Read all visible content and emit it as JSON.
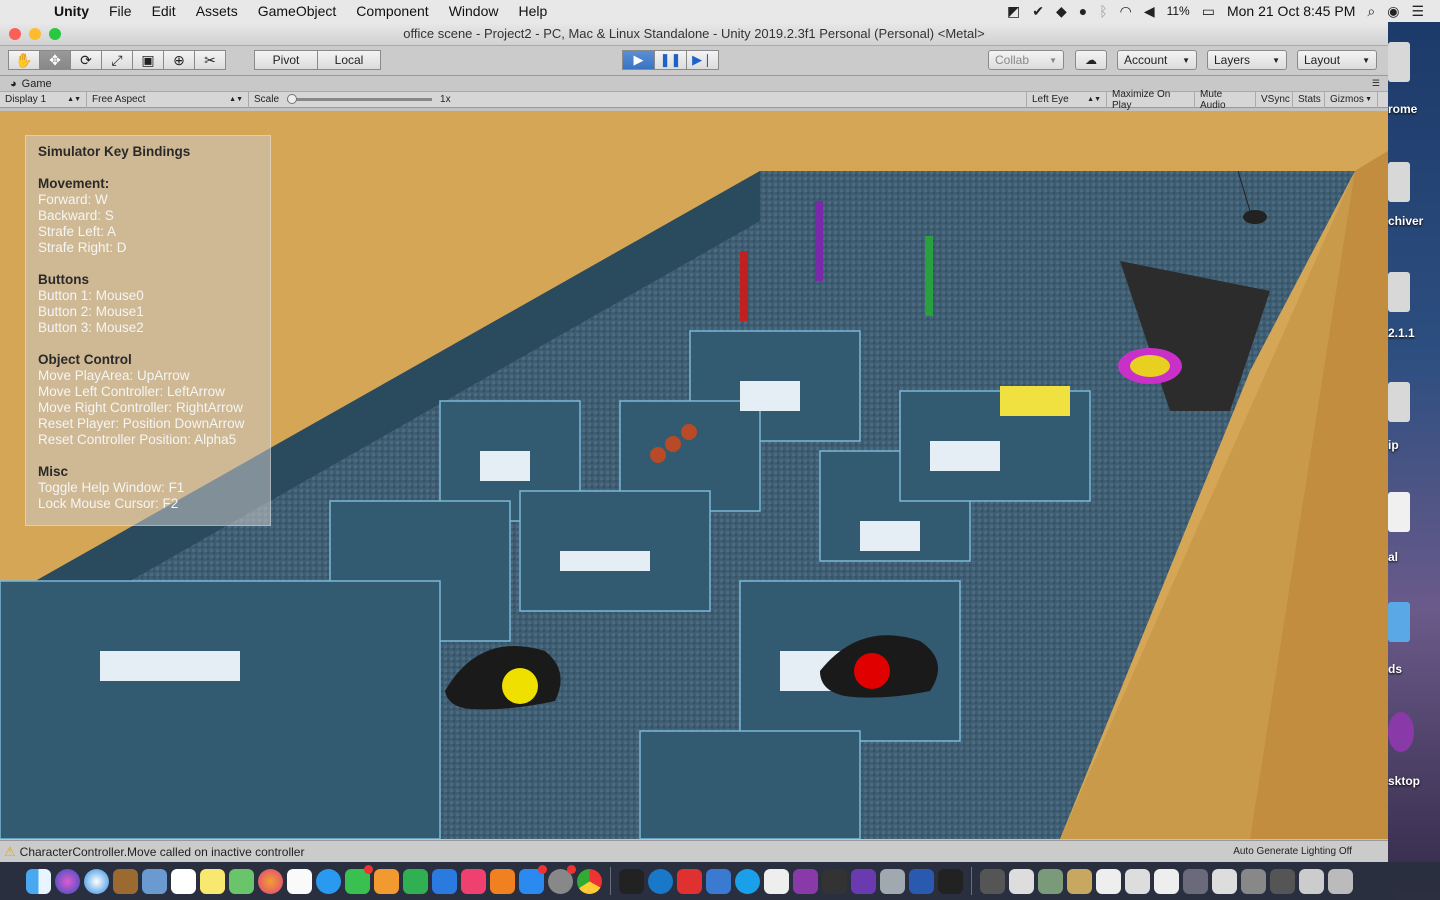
{
  "menubar": {
    "app_name": "Unity",
    "items": [
      "File",
      "Edit",
      "Assets",
      "GameObject",
      "Component",
      "Window",
      "Help"
    ],
    "battery": "11%",
    "datetime": "Mon 21 Oct  8:45 PM"
  },
  "window": {
    "title": "office scene - Project2 - PC, Mac & Linux Standalone - Unity 2019.2.3f1 Personal (Personal) <Metal>"
  },
  "toolbar": {
    "pivot_label": "Pivot",
    "local_label": "Local",
    "collab_label": "Collab",
    "account_label": "Account",
    "layers_label": "Layers",
    "layout_label": "Layout"
  },
  "game_view": {
    "tab_label": "Game",
    "display": "Display 1",
    "aspect": "Free Aspect",
    "scale_label": "Scale",
    "scale_value": "1x",
    "eye": "Left Eye",
    "buttons": [
      "Maximize On Play",
      "Mute Audio",
      "VSync",
      "Stats",
      "Gizmos"
    ]
  },
  "help_window": {
    "title": "Simulator Key Bindings",
    "sections": [
      {
        "heading": "Movement:",
        "lines": [
          "Forward: W",
          "Backward: S",
          "Strafe Left: A",
          "Strafe Right: D"
        ]
      },
      {
        "heading": "Buttons",
        "lines": [
          "Button 1: Mouse0",
          "Button 2: Mouse1",
          "Button 3: Mouse2"
        ]
      },
      {
        "heading": "Object Control",
        "lines": [
          "Move PlayArea: UpArrow",
          "Move Left Controller: LeftArrow",
          "Move Right Controller: RightArrow",
          "Reset Player: Position DownArrow",
          "Reset Controller Position: Alpha5"
        ]
      },
      {
        "heading": "Misc",
        "lines": [
          "Toggle Help Window: F1",
          "Lock Mouse Cursor: F2"
        ]
      }
    ]
  },
  "status": {
    "message": "CharacterController.Move called on inactive controller",
    "lighting": "Auto Generate Lighting Off"
  },
  "desktop": {
    "labels": [
      "rome",
      "chiver",
      "2.1.1",
      "ip",
      "al",
      "ds",
      "sktop"
    ]
  },
  "colors": {
    "accent_play": "#3b74c4",
    "floor": "#3d5a6e",
    "outer_wall": "#c99a4a",
    "grass": "#7fd42a"
  }
}
